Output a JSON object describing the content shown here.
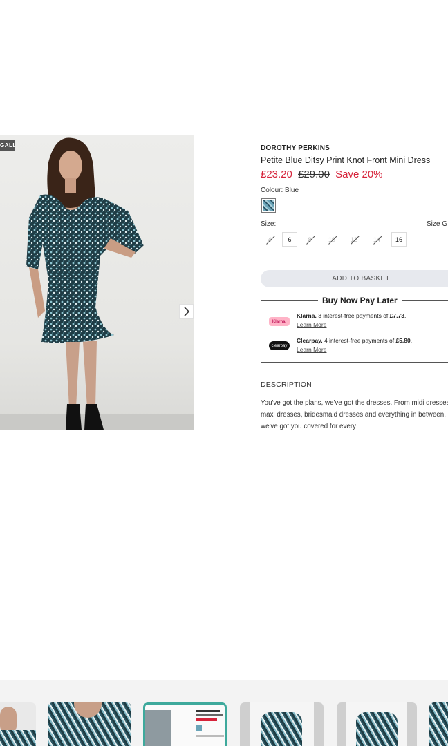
{
  "gallery": {
    "badge_label": "GALLERY",
    "next_icon": "chevron-right-icon"
  },
  "product": {
    "brand": "DOROTHY PERKINS",
    "title": "Petite Blue Ditsy Print Knot Front Mini Dress",
    "price_sale": "£23.20",
    "price_original": "£29.00",
    "price_save": "Save 20%",
    "colour_label": "Colour: Blue",
    "size_label": "Size:",
    "size_guide_label": "Size G",
    "sizes": [
      {
        "label": "4",
        "available": false
      },
      {
        "label": "6",
        "available": true
      },
      {
        "label": "8",
        "available": false
      },
      {
        "label": "10",
        "available": false
      },
      {
        "label": "12",
        "available": false
      },
      {
        "label": "14",
        "available": false
      },
      {
        "label": "16",
        "available": true
      }
    ],
    "add_to_basket": "ADD TO BASKET"
  },
  "bnpl": {
    "title": "Buy Now Pay Later",
    "klarna": {
      "logo": "Klarna.",
      "name": "Klarna.",
      "text": " 3 interest-free payments of ",
      "amount": "£7.73",
      "end": ".",
      "link": "Learn More"
    },
    "clearpay": {
      "logo": "clearpay",
      "name": "Clearpay.",
      "text": " 4 interest-free payments of ",
      "amount": "£5.80",
      "end": ".",
      "link": "Learn More"
    }
  },
  "description": {
    "heading": "DESCRIPTION",
    "text": "You've got the plans, we've got the dresses. From midi dresses to maxi dresses, bridesmaid dresses and everything in between, we've got you covered for every"
  },
  "colors": {
    "sale_red": "#d6233a",
    "active_thumb": "#3ea99c",
    "basket_bg": "#e7e9ee"
  }
}
